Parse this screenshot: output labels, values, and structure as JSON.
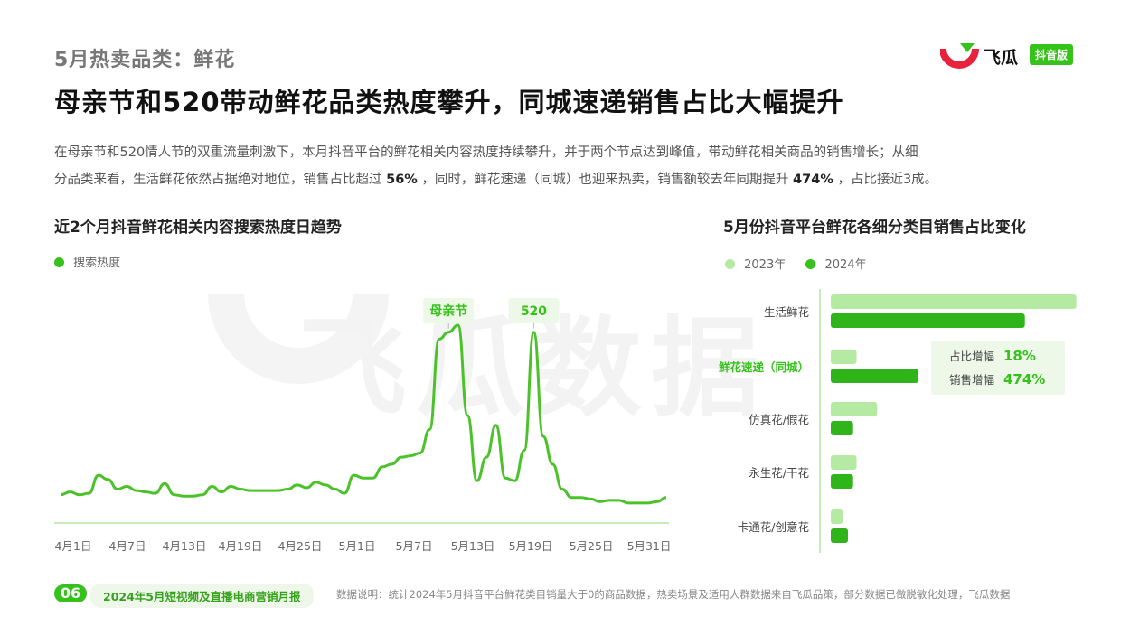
{
  "header": {
    "kicker": "5月热卖品类：鲜花",
    "headline": "母亲节和520带动鲜花品类热度攀升，同城速递销售占比大幅提升",
    "desc_line1": "在母亲节和520情人节的双重流量刺激下，本月抖音平台的鲜花相关内容热度持续攀升，并于两个节点达到峰值，带动鲜花相关商品的销售增长；从细",
    "desc_line2_a": "分品类来看，生活鲜花依然占据绝对地位，销售占比超过",
    "desc_line2_b": "56%",
    "desc_line2_c": "，同时，鲜花速递（同城）也迎来热卖，销售额较去年同期提升",
    "desc_line2_d": "474%",
    "desc_line2_e": "，占比接近3成。"
  },
  "logo": {
    "name": "飞瓜",
    "badge": "抖音版",
    "icon": "feigua-logo-icon",
    "watermark": "飞瓜数据"
  },
  "footer": {
    "page": "06",
    "report": "2024年5月短视频及直播电商营销月报",
    "note": "数据说明：统计2024年5月抖音平台鲜花类目销量大于0的商品数据，热卖场景及适用人群数据来自飞瓜品策，部分数据已做脱敏化处理，飞瓜数据"
  },
  "colors": {
    "green": "#35c21b",
    "light_green": "#b5eaa2",
    "dark_green": "#22a812",
    "muted": "#777777"
  },
  "chart_data": [
    {
      "type": "line",
      "title": "近2个月抖音鲜花相关内容搜索热度日趋势",
      "legend": "top-left",
      "series": [
        {
          "name": "搜索热度",
          "x_ticks": [
            "4月1日",
            "4月7日",
            "4月13日",
            "4月19日",
            "4月25日",
            "5月1日",
            "5月7日",
            "5月13日",
            "5月19日",
            "5月25日",
            "5月31日"
          ],
          "values": [
            8,
            10,
            8,
            9,
            22,
            19,
            12,
            14,
            11,
            10,
            9,
            16,
            8,
            7,
            7,
            8,
            14,
            10,
            14,
            12,
            11,
            11,
            11,
            11,
            12,
            15,
            13,
            17,
            15,
            12,
            9,
            22,
            20,
            20,
            28,
            30,
            35,
            36,
            38,
            55,
            120,
            125,
            130,
            65,
            18,
            35,
            58,
            20,
            18,
            40,
            125,
            50,
            30,
            12,
            6,
            6,
            5,
            3,
            4,
            4,
            2,
            2,
            2,
            3,
            6
          ]
        }
      ],
      "annotations": [
        {
          "label": "母亲节",
          "index": 41
        },
        {
          "label": "520",
          "index": 50
        }
      ],
      "grid": false
    },
    {
      "type": "bar",
      "title": "5月份抖音平台鲜花各细分类目销售占比变化",
      "legend": "top-left",
      "categories": [
        "生活鲜花",
        "鲜花速递（同城）",
        "仿真花/假花",
        "永生花/干花",
        "卡通花/创意花"
      ],
      "series": [
        {
          "name": "2023年",
          "values": [
            71.5,
            7.5,
            13.5,
            7.5,
            3.5
          ]
        },
        {
          "name": "2024年",
          "values": [
            56.5,
            25.5,
            6.5,
            6.5,
            5.0
          ]
        }
      ],
      "highlight": {
        "category": "鲜花速递（同城）",
        "share_growth_label": "占比增幅",
        "share_growth_value": "18%",
        "sales_growth_label": "销售增幅",
        "sales_growth_value": "474%"
      }
    }
  ]
}
